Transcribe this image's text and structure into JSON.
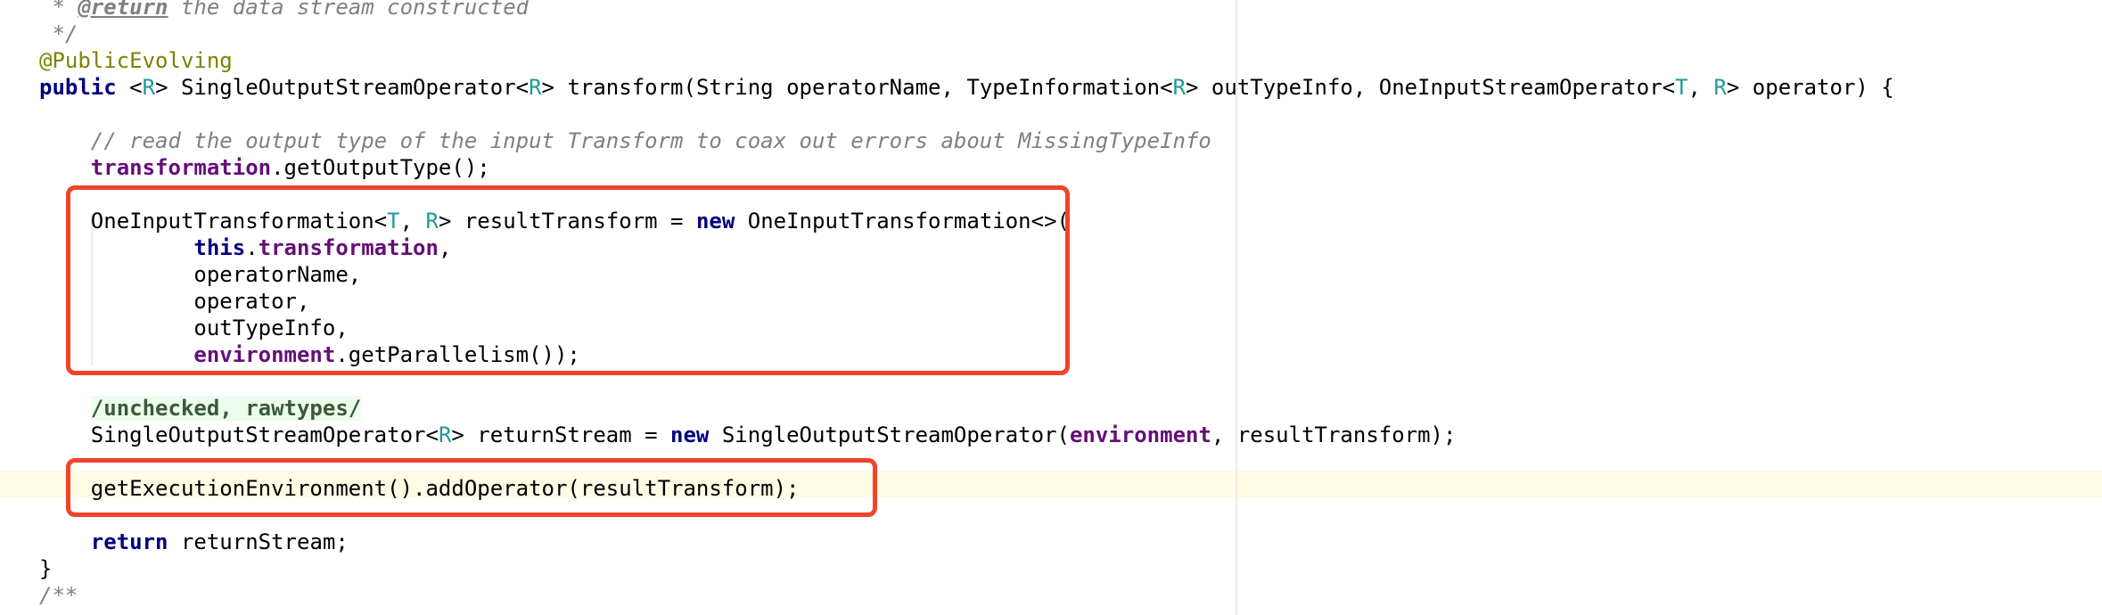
{
  "editor": {
    "colors": {
      "background": "#ffffff",
      "keyword": "#000080",
      "type_parameter": "#20999d",
      "field": "#660e7a",
      "comment": "#808080",
      "annotation": "#808000",
      "caret_line": "#fffbe5",
      "highlight_box": "#f1432c"
    },
    "lines": [
      {
        "name": "javadoc-return-line",
        "tokens": [
          {
            "t": " * ",
            "k": "comment-italic"
          },
          {
            "t": "@return",
            "k": "javadoc-tag"
          },
          {
            "t": " the data stream constructed",
            "k": "comment-italic"
          }
        ]
      },
      {
        "name": "javadoc-end-line",
        "tokens": [
          {
            "t": " */",
            "k": "comment-italic"
          }
        ]
      },
      {
        "name": "annotation-line",
        "tokens": [
          {
            "t": "@PublicEvolving",
            "k": "annotation"
          }
        ]
      },
      {
        "name": "method-signature-line",
        "tokens": [
          {
            "t": "public",
            "k": "keyword"
          },
          {
            "t": " <",
            "k": "plain"
          },
          {
            "t": "R",
            "k": "type-param"
          },
          {
            "t": "> SingleOutputStreamOperator<",
            "k": "plain"
          },
          {
            "t": "R",
            "k": "type-param"
          },
          {
            "t": "> transform(String operatorName, TypeInformation<",
            "k": "plain"
          },
          {
            "t": "R",
            "k": "type-param"
          },
          {
            "t": "> outTypeInfo, OneInputStreamOperator<",
            "k": "plain"
          },
          {
            "t": "T",
            "k": "type-param"
          },
          {
            "t": ", ",
            "k": "plain"
          },
          {
            "t": "R",
            "k": "type-param"
          },
          {
            "t": "> operator) {",
            "k": "plain"
          }
        ]
      },
      {
        "name": "blank-line",
        "tokens": []
      },
      {
        "name": "comment-line",
        "tokens": [
          {
            "t": "    // read the output type of the input Transform to coax out errors about MissingTypeInfo",
            "k": "comment-italic"
          }
        ]
      },
      {
        "name": "get-output-type-line",
        "tokens": [
          {
            "t": "    ",
            "k": "plain"
          },
          {
            "t": "transformation",
            "k": "field"
          },
          {
            "t": ".getOutputType();",
            "k": "plain"
          }
        ]
      },
      {
        "name": "blank-line",
        "tokens": []
      },
      {
        "name": "result-transform-decl-line",
        "tokens": [
          {
            "t": "    OneInputTransformation<",
            "k": "plain"
          },
          {
            "t": "T",
            "k": "type-param"
          },
          {
            "t": ", ",
            "k": "plain"
          },
          {
            "t": "R",
            "k": "type-param"
          },
          {
            "t": "> resultTransform = ",
            "k": "plain"
          },
          {
            "t": "new",
            "k": "keyword"
          },
          {
            "t": " OneInputTransformation<>(",
            "k": "plain"
          }
        ]
      },
      {
        "name": "arg-transformation-line",
        "tokens": [
          {
            "t": "            ",
            "k": "plain"
          },
          {
            "t": "this",
            "k": "keyword"
          },
          {
            "t": ".",
            "k": "plain"
          },
          {
            "t": "transformation",
            "k": "field"
          },
          {
            "t": ",",
            "k": "plain"
          }
        ]
      },
      {
        "name": "arg-operator-name-line",
        "tokens": [
          {
            "t": "            operatorName,",
            "k": "plain"
          }
        ]
      },
      {
        "name": "arg-operator-line",
        "tokens": [
          {
            "t": "            operator,",
            "k": "plain"
          }
        ]
      },
      {
        "name": "arg-out-type-info-line",
        "tokens": [
          {
            "t": "            outTypeInfo,",
            "k": "plain"
          }
        ]
      },
      {
        "name": "arg-parallelism-line",
        "tokens": [
          {
            "t": "            ",
            "k": "plain"
          },
          {
            "t": "environment",
            "k": "field"
          },
          {
            "t": ".getParallelism());",
            "k": "plain"
          }
        ]
      },
      {
        "name": "blank-line",
        "tokens": []
      },
      {
        "name": "suppress-warnings-fold-line",
        "tokens": [
          {
            "t": "    ",
            "k": "plain"
          },
          {
            "t": "/unchecked, rawtypes/",
            "k": "suppression"
          }
        ]
      },
      {
        "name": "return-stream-decl-line",
        "tokens": [
          {
            "t": "    SingleOutputStreamOperator<",
            "k": "plain"
          },
          {
            "t": "R",
            "k": "type-param"
          },
          {
            "t": "> returnStream = ",
            "k": "plain"
          },
          {
            "t": "new",
            "k": "keyword"
          },
          {
            "t": " SingleOutputStreamOperator(",
            "k": "plain"
          },
          {
            "t": "environment",
            "k": "field"
          },
          {
            "t": ", resultTransform);",
            "k": "plain"
          }
        ]
      },
      {
        "name": "blank-line",
        "tokens": []
      },
      {
        "name": "add-operator-line",
        "tokens": [
          {
            "t": "    getExecutionEnvironment().addOperator(resultTransform);",
            "k": "plain"
          }
        ]
      },
      {
        "name": "blank-line",
        "tokens": []
      },
      {
        "name": "return-statement-line",
        "tokens": [
          {
            "t": "    ",
            "k": "plain"
          },
          {
            "t": "return",
            "k": "keyword"
          },
          {
            "t": " returnStream;",
            "k": "plain"
          }
        ]
      },
      {
        "name": "closing-brace-line",
        "tokens": [
          {
            "t": "}",
            "k": "plain"
          }
        ]
      },
      {
        "name": "next-javadoc-start-line",
        "tokens": [
          {
            "t": "/**",
            "k": "comment-italic"
          }
        ]
      }
    ],
    "highlights": [
      {
        "name": "result-transform-highlight-box",
        "label": "OneInputTransformation construction"
      },
      {
        "name": "add-operator-highlight-box",
        "label": "addOperator call"
      }
    ]
  }
}
